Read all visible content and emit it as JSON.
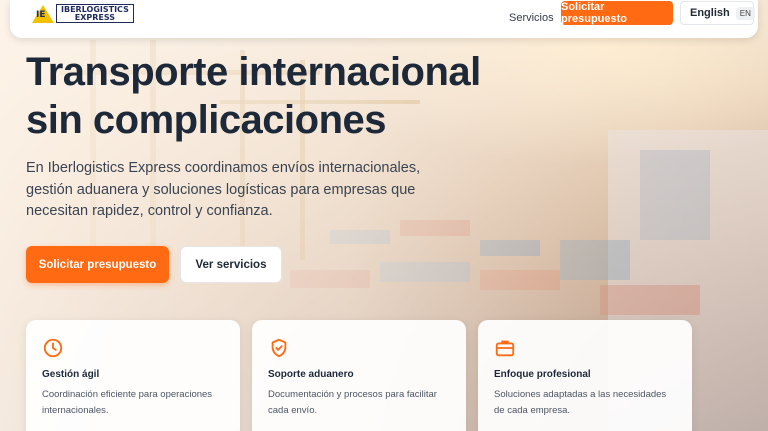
{
  "brand": {
    "logo_mark": "IE",
    "logo_line1": "IBERLOGISTICS",
    "logo_line2": "EXPRESS"
  },
  "nav": {
    "services_link": "Servicios",
    "quote_button": "Solicitar presupuesto",
    "language_label": "English",
    "language_code": "EN"
  },
  "hero": {
    "title_line1": "Transporte internacional",
    "title_line2": "sin complicaciones",
    "description": "En Iberlogistics Express coordinamos envíos internacionales, gestión aduanera y soluciones logísticas para empresas que necesitan rapidez, control y confianza.",
    "primary_button": "Solicitar presupuesto",
    "secondary_button": "Ver servicios"
  },
  "features": [
    {
      "icon": "clock-icon",
      "title": "Gestión ágil",
      "text": "Coordinación eficiente para operaciones internacionales."
    },
    {
      "icon": "shield-check-icon",
      "title": "Soporte aduanero",
      "text": "Documentación y procesos para facilitar cada envío."
    },
    {
      "icon": "briefcase-icon",
      "title": "Enfoque profesional",
      "text": "Soluciones adaptadas a las necesidades de cada empresa."
    }
  ],
  "colors": {
    "accent": "#ff6a12",
    "heading": "#1d2838",
    "logo_navy": "#1f2a5a",
    "logo_yellow": "#f2c200"
  }
}
